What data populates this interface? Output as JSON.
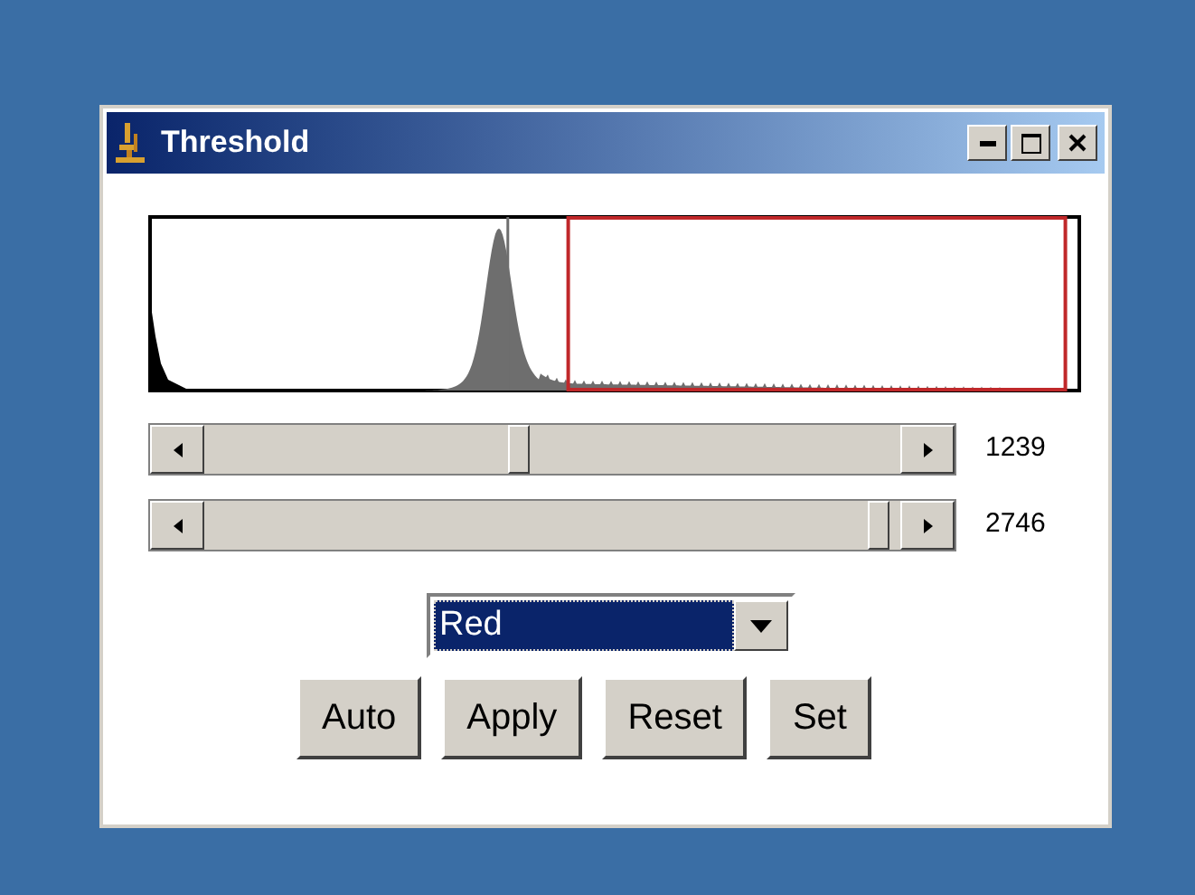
{
  "window": {
    "title": "Threshold"
  },
  "sliders": [
    {
      "reading": "1239"
    },
    {
      "reading": "2746"
    }
  ],
  "dropdown": {
    "value": "Red"
  },
  "buttons": [
    "Auto",
    "Apply",
    "Reset",
    "Set"
  ]
}
